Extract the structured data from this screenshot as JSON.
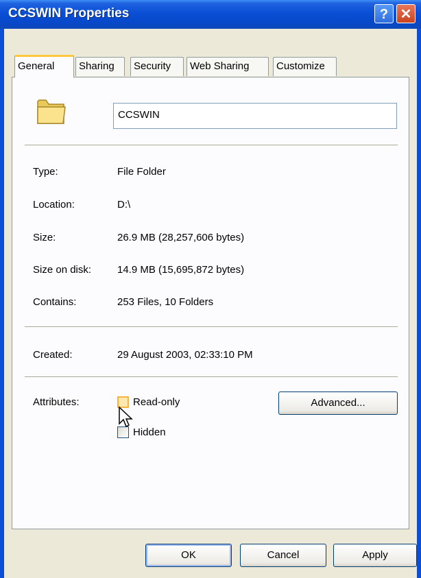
{
  "window": {
    "title": "CCSWIN Properties",
    "help_glyph": "?",
    "close_glyph": "✕"
  },
  "tabs": [
    {
      "label": "General",
      "active": true
    },
    {
      "label": "Sharing",
      "active": false
    },
    {
      "label": "Security",
      "active": false
    },
    {
      "label": "Web Sharing",
      "active": false
    },
    {
      "label": "Customize",
      "active": false
    }
  ],
  "general": {
    "icon": "folder-icon",
    "name": "CCSWIN",
    "type_label": "Type:",
    "type_value": "File Folder",
    "location_label": "Location:",
    "location_value": "D:\\",
    "size_label": "Size:",
    "size_value": "26.9 MB (28,257,606 bytes)",
    "size_on_disk_label": "Size on disk:",
    "size_on_disk_value": "14.9 MB (15,695,872 bytes)",
    "contains_label": "Contains:",
    "contains_value": "253 Files, 10 Folders",
    "created_label": "Created:",
    "created_value": "29 August 2003, 02:33:10 PM",
    "attributes_label": "Attributes:",
    "readonly_label": "Read-only",
    "readonly_checked": false,
    "hidden_label": "Hidden",
    "hidden_checked": false,
    "advanced_label": "Advanced..."
  },
  "buttons": {
    "ok": "OK",
    "cancel": "Cancel",
    "apply": "Apply"
  },
  "colors": {
    "titlebar": "#0a4fd6",
    "dialog_bg": "#ece9d8",
    "active_tab_accent": "#ffc83c"
  }
}
